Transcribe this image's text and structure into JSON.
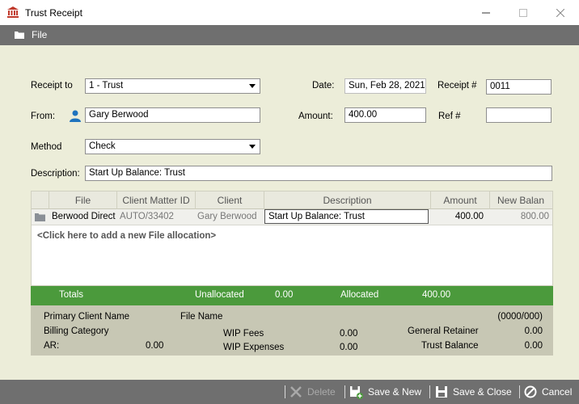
{
  "window": {
    "title": "Trust Receipt"
  },
  "menu": {
    "file": "File"
  },
  "form": {
    "receipt_to_label": "Receipt to",
    "receipt_to_value": "1 - Trust",
    "date_label": "Date:",
    "date_value": "Sun, Feb 28, 2021",
    "receipt_no_label": "Receipt #",
    "receipt_no_value": "0011",
    "from_label": "From:",
    "from_value": "Gary Berwood",
    "amount_label": "Amount:",
    "amount_value": "400.00",
    "ref_label": "Ref #",
    "ref_value": "",
    "method_label": "Method",
    "method_value": "Check",
    "description_label": "Description:",
    "description_value": "Start Up Balance: Trust"
  },
  "grid": {
    "columns": [
      "File",
      "Client Matter ID",
      "Client",
      "Description",
      "Amount",
      "New Balan"
    ],
    "rows": [
      {
        "file": "Berwood Direct",
        "client_matter_id": "AUTO/33402",
        "client": "Gary Berwood",
        "description": "Start Up Balance: Trust",
        "amount": "400.00",
        "new_balance": "800.00"
      }
    ],
    "add_row_text": "<Click here to add a new File allocation>"
  },
  "totals": {
    "label": "Totals",
    "unallocated_label": "Unallocated",
    "unallocated_value": "0.00",
    "allocated_label": "Allocated",
    "allocated_value": "400.00"
  },
  "info": {
    "primary_client_label": "Primary Client Name",
    "file_name_label": "File Name",
    "file_code": "(0000/000)",
    "billing_category_label": "Billing Category",
    "wip_fees_label": "WIP Fees",
    "wip_fees_value": "0.00",
    "general_retainer_label": "General Retainer",
    "general_retainer_value": "0.00",
    "ar_label": "AR:",
    "ar_value": "0.00",
    "wip_expenses_label": "WIP Expenses",
    "wip_expenses_value": "0.00",
    "trust_balance_label": "Trust Balance",
    "trust_balance_value": "0.00"
  },
  "footer": {
    "delete_label": "Delete",
    "save_new_label": "Save & New",
    "save_close_label": "Save & Close",
    "cancel_label": "Cancel"
  },
  "colors": {
    "totals_bar": "#4b9a3c",
    "menubar": "#6f6f6f",
    "form_bg": "#ecedd9",
    "info_bg": "#c7c7b4"
  }
}
